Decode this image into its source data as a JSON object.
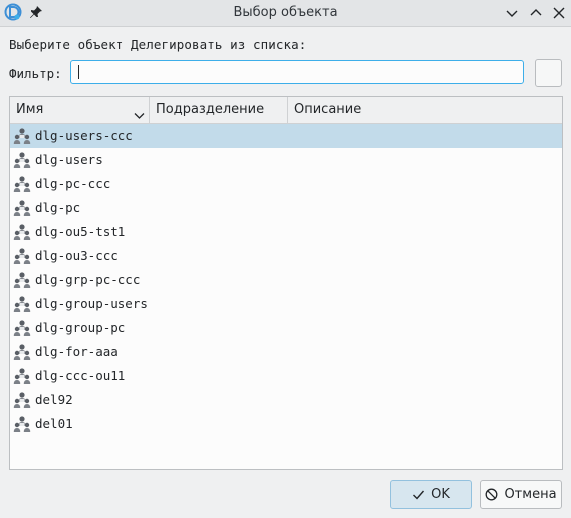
{
  "window": {
    "title": "Выбор объекта",
    "icons": [
      "app-icon",
      "pin-icon",
      "minimize-icon",
      "maximize-icon",
      "close-icon"
    ]
  },
  "prompt": "Выберите объект Делегировать из списка:",
  "filter": {
    "label": "Фильтр:",
    "value": ""
  },
  "table": {
    "columns": [
      "Имя",
      "Подразделение",
      "Описание"
    ],
    "rows": [
      {
        "name": "dlg-users-ccc",
        "selected": true
      },
      {
        "name": "dlg-users"
      },
      {
        "name": "dlg-pc-ccc"
      },
      {
        "name": "dlg-pc"
      },
      {
        "name": "dlg-ou5-tst1"
      },
      {
        "name": "dlg-ou3-ccc"
      },
      {
        "name": "dlg-grp-pc-ccc"
      },
      {
        "name": "dlg-group-users"
      },
      {
        "name": "dlg-group-pc"
      },
      {
        "name": "dlg-for-aaa"
      },
      {
        "name": "dlg-ccc-ou11"
      },
      {
        "name": "del92"
      },
      {
        "name": "del01"
      }
    ],
    "row_icon": "group-icon"
  },
  "buttons": {
    "ok": "OK",
    "cancel": "Отмена"
  },
  "colors": {
    "accent": "#3daee9",
    "selection": "#c2dbea"
  }
}
